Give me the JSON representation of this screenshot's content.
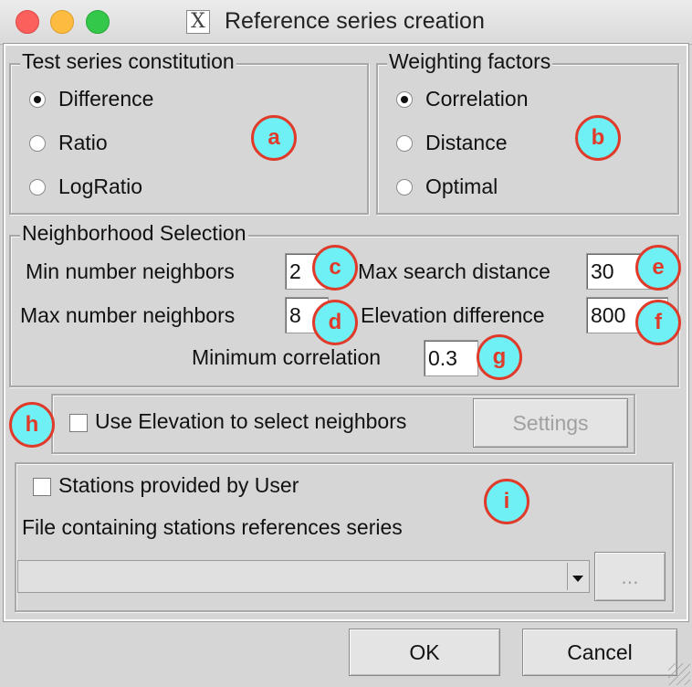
{
  "window": {
    "title": "Reference series creation",
    "app_icon": "x11-icon"
  },
  "test_series": {
    "title": "Test series constitution",
    "options": [
      "Difference",
      "Ratio",
      "LogRatio"
    ],
    "selected": "Difference"
  },
  "weighting": {
    "title": "Weighting factors",
    "options": [
      "Correlation",
      "Distance",
      "Optimal"
    ],
    "selected": "Correlation"
  },
  "neighborhood": {
    "title": "Neighborhood Selection",
    "min_neighbors_label": "Min number neighbors",
    "min_neighbors_value": "2",
    "max_neighbors_label": "Max number neighbors",
    "max_neighbors_value": "8",
    "max_search_label": "Max search distance",
    "max_search_value": "30",
    "elevation_diff_label": "Elevation difference",
    "elevation_diff_value": "800",
    "min_corr_label": "Minimum correlation",
    "min_corr_value": "0.3"
  },
  "elevation": {
    "use_label": "Use Elevation to select neighbors",
    "checked": false,
    "settings_label": "Settings"
  },
  "stations": {
    "user_label": "Stations provided by User",
    "checked": false,
    "file_label": "File containing stations references series",
    "combo_value": "",
    "browse_label": "..."
  },
  "buttons": {
    "ok": "OK",
    "cancel": "Cancel"
  },
  "annotations": [
    "a",
    "b",
    "c",
    "d",
    "e",
    "f",
    "g",
    "h",
    "i"
  ],
  "colors": {
    "badge_fill": "#6ff0f5",
    "badge_border": "#e03b2a",
    "window_bg": "#d6d6d6"
  }
}
